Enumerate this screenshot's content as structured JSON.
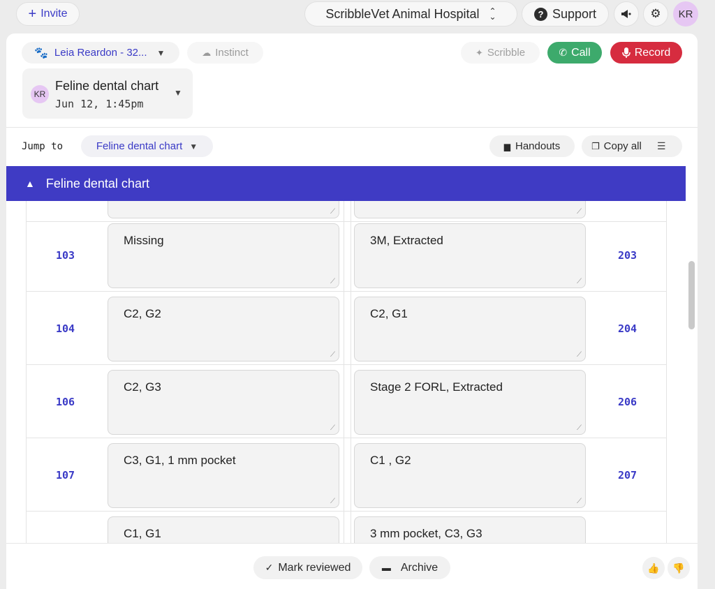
{
  "topbar": {
    "invite_label": "Invite",
    "hospital": "ScribbleVet Animal Hospital",
    "support_label": "Support",
    "avatar": "KR"
  },
  "header": {
    "patient": "Leia Reardon - 32...",
    "instinct": "Instinct",
    "scribble": "Scribble",
    "call": "Call",
    "record": "Record",
    "visit_avatar": "KR",
    "visit_title": "Feline dental chart",
    "visit_date": "Jun 12, 1:45pm"
  },
  "toolbar": {
    "jump_label": "Jump to",
    "jump_value": "Feline dental chart",
    "handouts": "Handouts",
    "copy_all": "Copy all"
  },
  "section": {
    "title": "Feline dental chart"
  },
  "teeth": [
    {
      "left_num": "103",
      "left_note": "Missing",
      "right_note": "3M, Extracted",
      "right_num": "203"
    },
    {
      "left_num": "104",
      "left_note": "C2, G2",
      "right_note": "C2, G1",
      "right_num": "204"
    },
    {
      "left_num": "106",
      "left_note": "C2, G3",
      "right_note": "Stage 2 FORL, Extracted",
      "right_num": "206"
    },
    {
      "left_num": "107",
      "left_note": "C3, G1, 1 mm pocket",
      "right_note": "C1 , G2",
      "right_num": "207"
    },
    {
      "left_num": "",
      "left_note": "C1, G1",
      "right_note": "3 mm pocket, C3, G3",
      "right_num": ""
    }
  ],
  "footer": {
    "mark_reviewed": "Mark reviewed",
    "archive": "Archive"
  },
  "colors": {
    "accent": "#3f3bc4",
    "call": "#3daa6c",
    "record": "#d62c3f"
  }
}
